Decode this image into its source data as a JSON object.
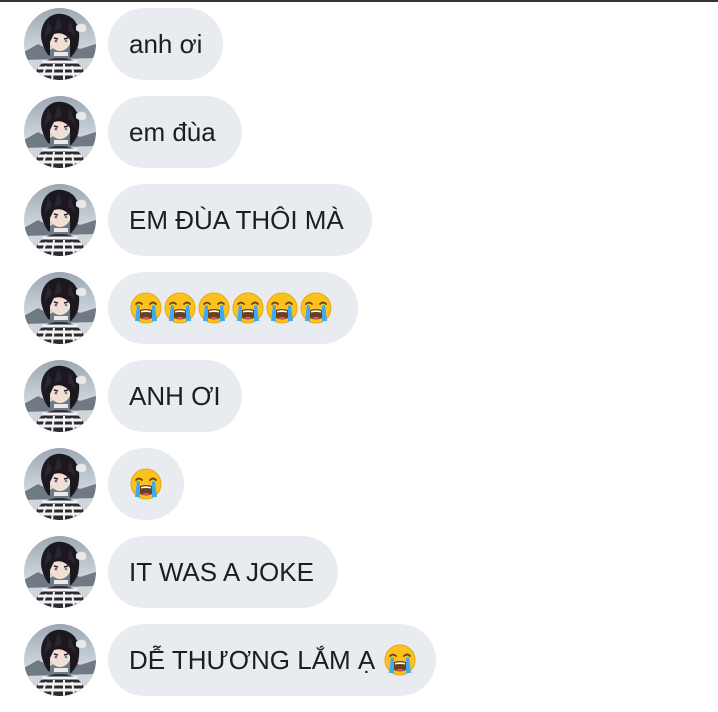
{
  "messages": [
    {
      "text": "anh ơi",
      "emoji_count": 0
    },
    {
      "text": "em đùa",
      "emoji_count": 0
    },
    {
      "text": "EM ĐÙA THÔI MÀ",
      "emoji_count": 0
    },
    {
      "text": "",
      "emoji_count": 6
    },
    {
      "text": "ANH ƠI",
      "emoji_count": 0
    },
    {
      "text": "",
      "emoji_count": 1
    },
    {
      "text": "IT WAS A JOKE",
      "emoji_count": 0
    },
    {
      "text": "DỄ THƯƠNG LẮM Ạ",
      "emoji_count": 1
    }
  ],
  "emoji": "loudly-crying-face-icon",
  "colors": {
    "bubble_bg": "#e8ebf0",
    "text": "#1c1e21",
    "top_border": "#333333"
  }
}
